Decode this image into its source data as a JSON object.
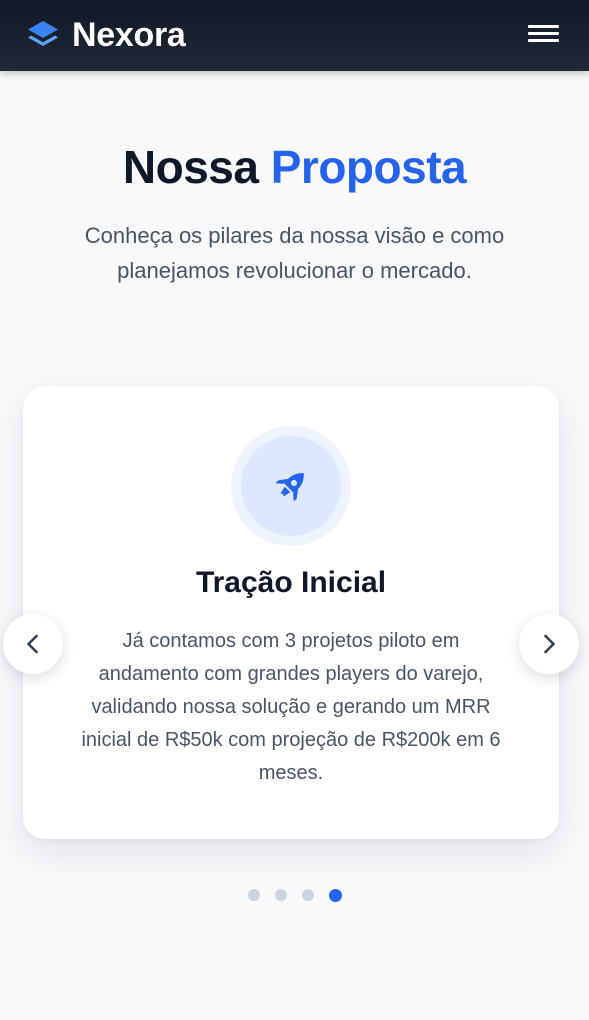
{
  "header": {
    "brand_name": "Nexora",
    "logo_icon": "layers-icon",
    "menu_icon": "hamburger-menu-icon"
  },
  "section": {
    "title_main": "Nossa",
    "title_accent": "Proposta",
    "subtitle": "Conheça os pilares da nossa visão e como planejamos revolucionar o mercado."
  },
  "carousel": {
    "slide": {
      "icon": "rocket-icon",
      "title": "Tração Inicial",
      "text": "Já contamos com 3 projetos piloto em andamento com grandes players do varejo, validando nossa solução e gerando um MRR inicial de R$50k com projeção de R$200k em 6 meses."
    },
    "prev_icon": "chevron-left-icon",
    "next_icon": "chevron-right-icon",
    "total_slides": 4,
    "active_slide": 4
  },
  "colors": {
    "accent": "#2563eb",
    "header_bg": "#111827",
    "page_bg": "#f8f9fb",
    "dot_inactive": "#cbd5e1"
  }
}
